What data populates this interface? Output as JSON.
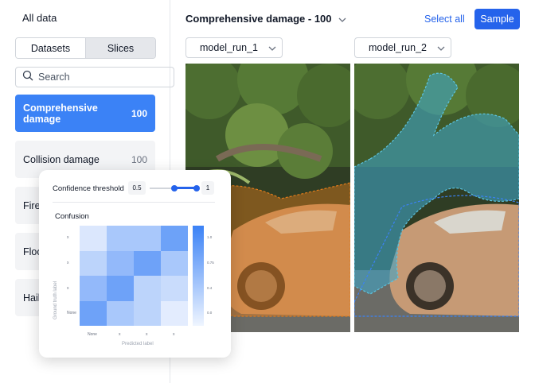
{
  "sidebar": {
    "title": "All data",
    "tabs": [
      {
        "label": "Datasets",
        "active": true
      },
      {
        "label": "Slices",
        "active": false
      }
    ],
    "search": {
      "placeholder": "Search",
      "value": ""
    },
    "slices": [
      {
        "label": "Comprehensive damage",
        "count": "100",
        "selected": true
      },
      {
        "label": "Collision damage",
        "count": "100",
        "selected": false
      },
      {
        "label": "Fire",
        "count": "",
        "selected": false
      },
      {
        "label": "Flood",
        "count": "",
        "selected": false
      },
      {
        "label": "Hail",
        "count": "",
        "selected": false
      }
    ]
  },
  "main": {
    "title": "Comprehensive damage - 100",
    "select_all_label": "Select all",
    "sample_label": "Sample",
    "runs": [
      {
        "label": "model_run_1",
        "color": "#f0913a"
      },
      {
        "label": "model_run_2",
        "color": "#3b82f6"
      }
    ]
  },
  "overlay": {
    "confidence": {
      "label": "Confidence threshold",
      "min": "0.5",
      "max": "1"
    },
    "confusion": {
      "title": "Confusion",
      "ylabel": "Ground truth label",
      "xlabel": "Predicted label",
      "row_ticks": [
        "x",
        "x",
        "x",
        "None"
      ],
      "col_ticks": [
        "None",
        "x",
        "x",
        "x"
      ],
      "colorbar_ticks": [
        "1.0",
        "0.75",
        "0.4",
        "0.0"
      ],
      "cell_colors": [
        [
          "#dbe7fd",
          "#a9c8fb",
          "#a9c8fb",
          "#6da2f8"
        ],
        [
          "#bcd4fb",
          "#93b9fa",
          "#6ea2f8",
          "#a9c8fb"
        ],
        [
          "#93b9fa",
          "#6ea2f8",
          "#bcd4fb",
          "#c9dcfc"
        ],
        [
          "#6ea2f8",
          "#a9c8fb",
          "#bcd4fb",
          "#e3ecfe"
        ]
      ]
    }
  }
}
